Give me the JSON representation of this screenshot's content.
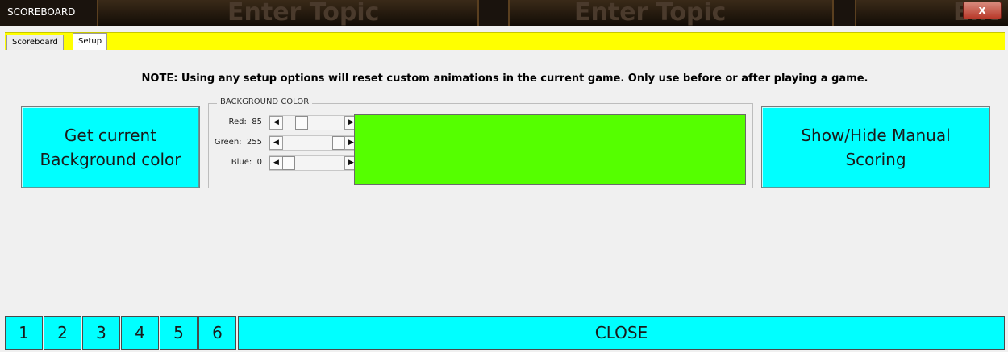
{
  "window": {
    "title": "SCOREBOARD",
    "close_glyph": "x",
    "bg_text": [
      "Enter Topic",
      "Enter Topic",
      "Ent"
    ]
  },
  "tabs": [
    {
      "label": "Scoreboard"
    },
    {
      "label": "Setup",
      "active": true
    }
  ],
  "note": "NOTE: Using any setup options will reset custom animations in the current game.  Only use before or after playing a game.",
  "buttons": {
    "get_bg_line1": "Get current",
    "get_bg_line2": "Background color",
    "toggle_line1": "Show/Hide Manual",
    "toggle_line2": "Scoring",
    "close": "CLOSE"
  },
  "background_color": {
    "title": "BACKGROUND COLOR",
    "sliders": [
      {
        "label": "Red:",
        "value": "85",
        "level": 85
      },
      {
        "label": "Green:",
        "value": "255",
        "level": 255
      },
      {
        "label": "Blue:",
        "value": "0",
        "level": 0
      }
    ],
    "preview_color": "#55ff00"
  },
  "number_buttons": [
    "1",
    "2",
    "3",
    "4",
    "5",
    "6"
  ],
  "colors": {
    "accent": "#00ffff",
    "tab_strip": "#ffff00"
  }
}
